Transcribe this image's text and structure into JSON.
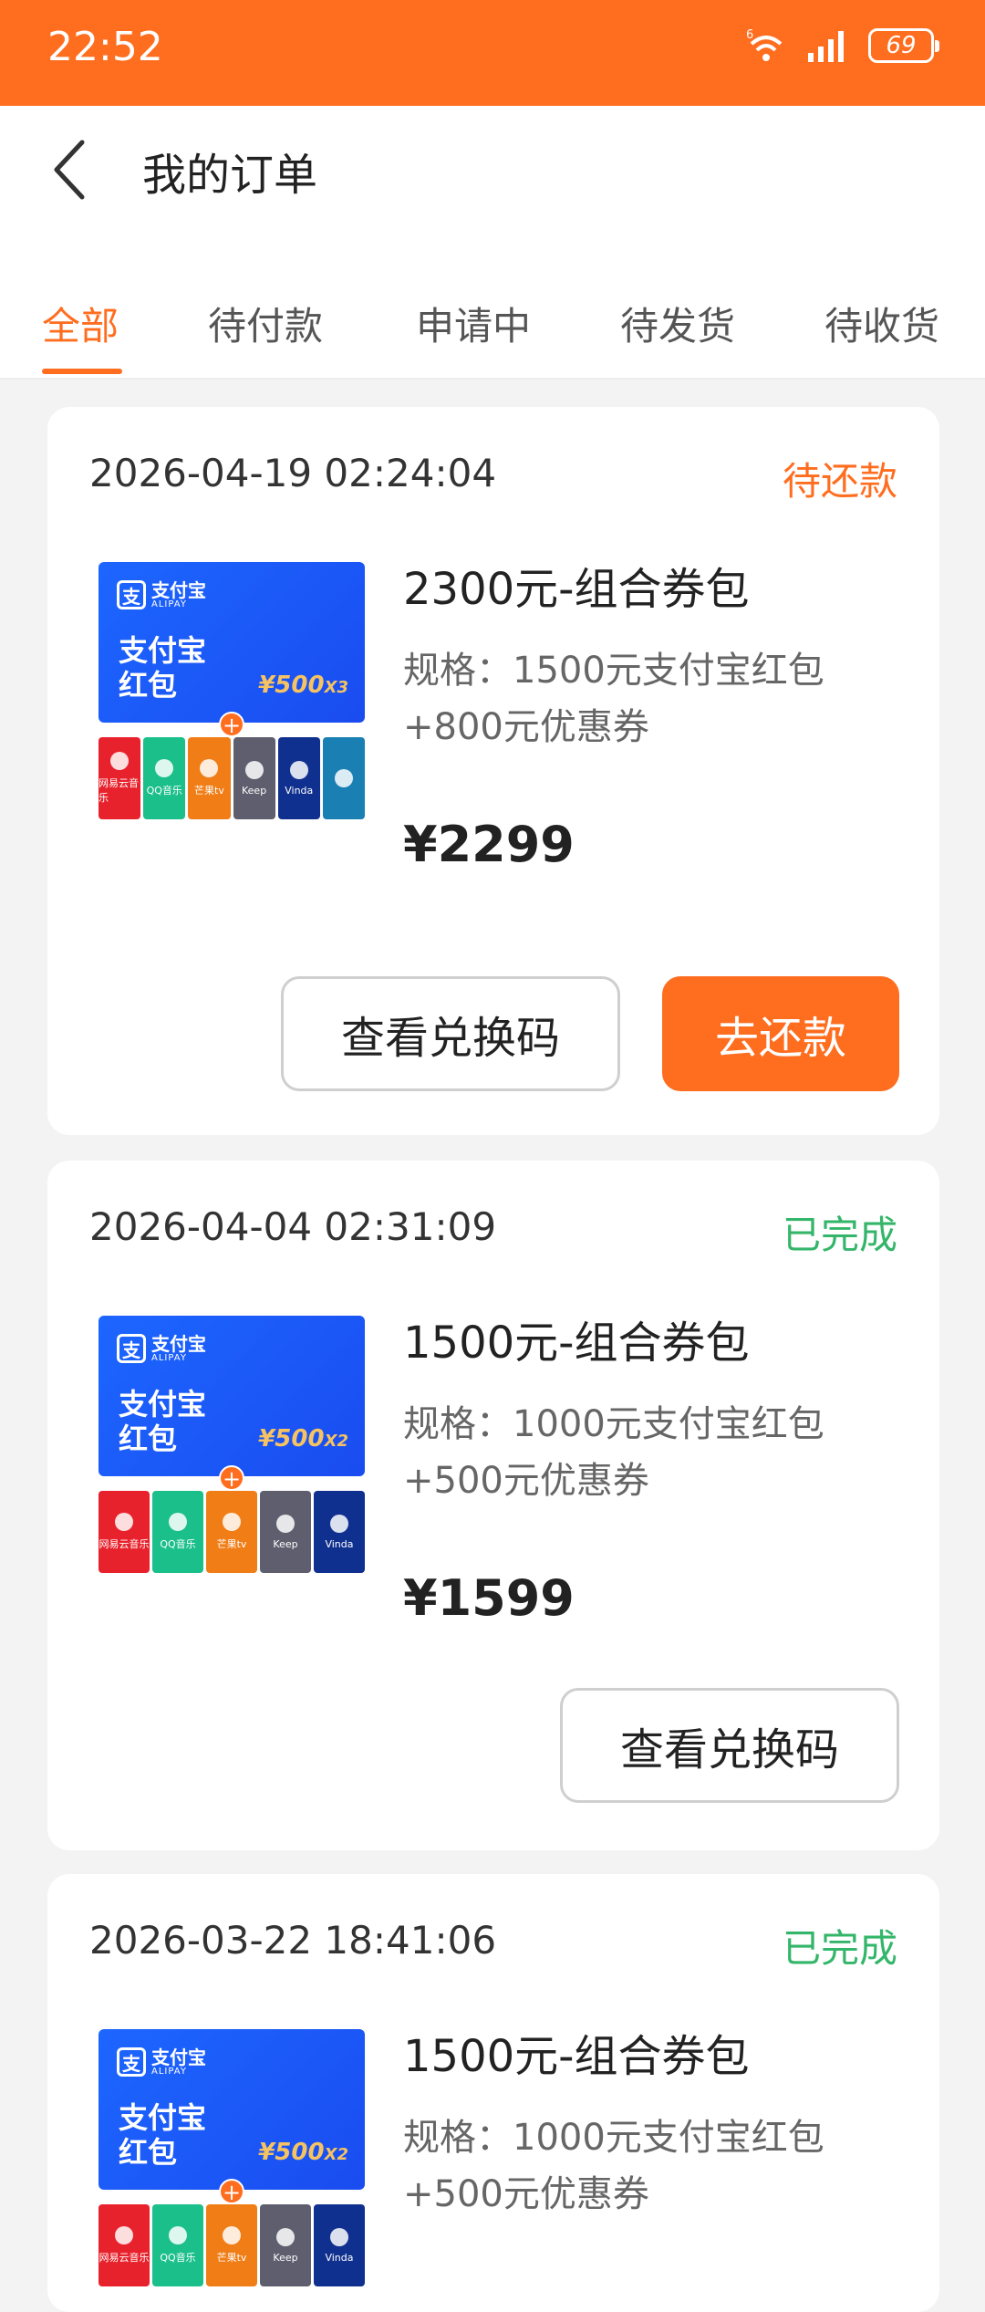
{
  "status_bar": {
    "time": "22:52",
    "battery": "69",
    "network_badge": "6"
  },
  "header": {
    "title": "我的订单"
  },
  "tabs": [
    {
      "label": "全部"
    },
    {
      "label": "待付款"
    },
    {
      "label": "申请中"
    },
    {
      "label": "待发货"
    },
    {
      "label": "待收货"
    }
  ],
  "orders": [
    {
      "time": "2026-04-19 02:24:04",
      "status": "待还款",
      "thumb": {
        "logo": "支付宝",
        "logo_sub": "ALIPAY",
        "title_line1": "支付宝",
        "title_line2": "红包",
        "amount": "¥500",
        "multiplier": "X3"
      },
      "name": "2300元-组合券包",
      "spec_line1": "规格：1500元支付宝红包",
      "spec_line2": "+800元优惠券",
      "price": "¥2299",
      "buttons": {
        "redeem": "查看兑换码",
        "repay": "去还款"
      }
    },
    {
      "time": "2026-04-04 02:31:09",
      "status": "已完成",
      "thumb": {
        "logo": "支付宝",
        "logo_sub": "ALIPAY",
        "title_line1": "支付宝",
        "title_line2": "红包",
        "amount": "¥500",
        "multiplier": "X2"
      },
      "name": "1500元-组合券包",
      "spec_line1": "规格：1000元支付宝红包",
      "spec_line2": "+500元优惠券",
      "price": "¥1599",
      "buttons": {
        "redeem": "查看兑换码"
      }
    },
    {
      "time": "2026-03-22 18:41:06",
      "status": "已完成",
      "thumb": {
        "logo": "支付宝",
        "logo_sub": "ALIPAY",
        "title_line1": "支付宝",
        "title_line2": "红包",
        "amount": "¥500",
        "multiplier": "X2"
      },
      "name": "1500元-组合券包",
      "spec_line1": "规格：1000元支付宝红包",
      "spec_line2": "+500元优惠券"
    }
  ],
  "brands": [
    "网易云音乐",
    "QQ音乐",
    "芒果tv",
    "Keep",
    "Vinda"
  ],
  "colors": {
    "accent": "#ff6d1f",
    "done": "#34b66a"
  }
}
